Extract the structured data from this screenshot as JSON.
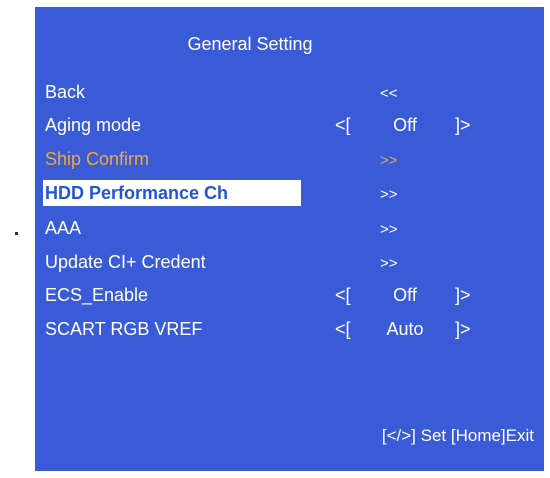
{
  "menu": {
    "title": "General Setting",
    "items": [
      {
        "label": "Back",
        "value": "<<"
      },
      {
        "label": "Aging mode",
        "left_bracket": "<[",
        "value": "Off",
        "right_bracket": "]>"
      },
      {
        "label": "Ship Confirm",
        "value": ">>"
      },
      {
        "label": "HDD Performance Ch",
        "value": ">>"
      },
      {
        "label": "AAA",
        "value": ">>"
      },
      {
        "label": "Update CI+ Credent",
        "value": ">>"
      },
      {
        "label": "ECS_Enable",
        "left_bracket": "<[",
        "value": "Off",
        "right_bracket": "]>"
      },
      {
        "label": "SCART RGB VREF",
        "left_bracket": "<[",
        "value": "Auto",
        "right_bracket": "]>"
      }
    ]
  },
  "footer": {
    "hint": "[</>] Set [Home]Exit"
  },
  "colors": {
    "background": "#3a5bd8",
    "text": "#ffffff",
    "highlight_text": "#f0a830",
    "selected_bg": "#ffffff",
    "selected_text": "#2255dd"
  }
}
